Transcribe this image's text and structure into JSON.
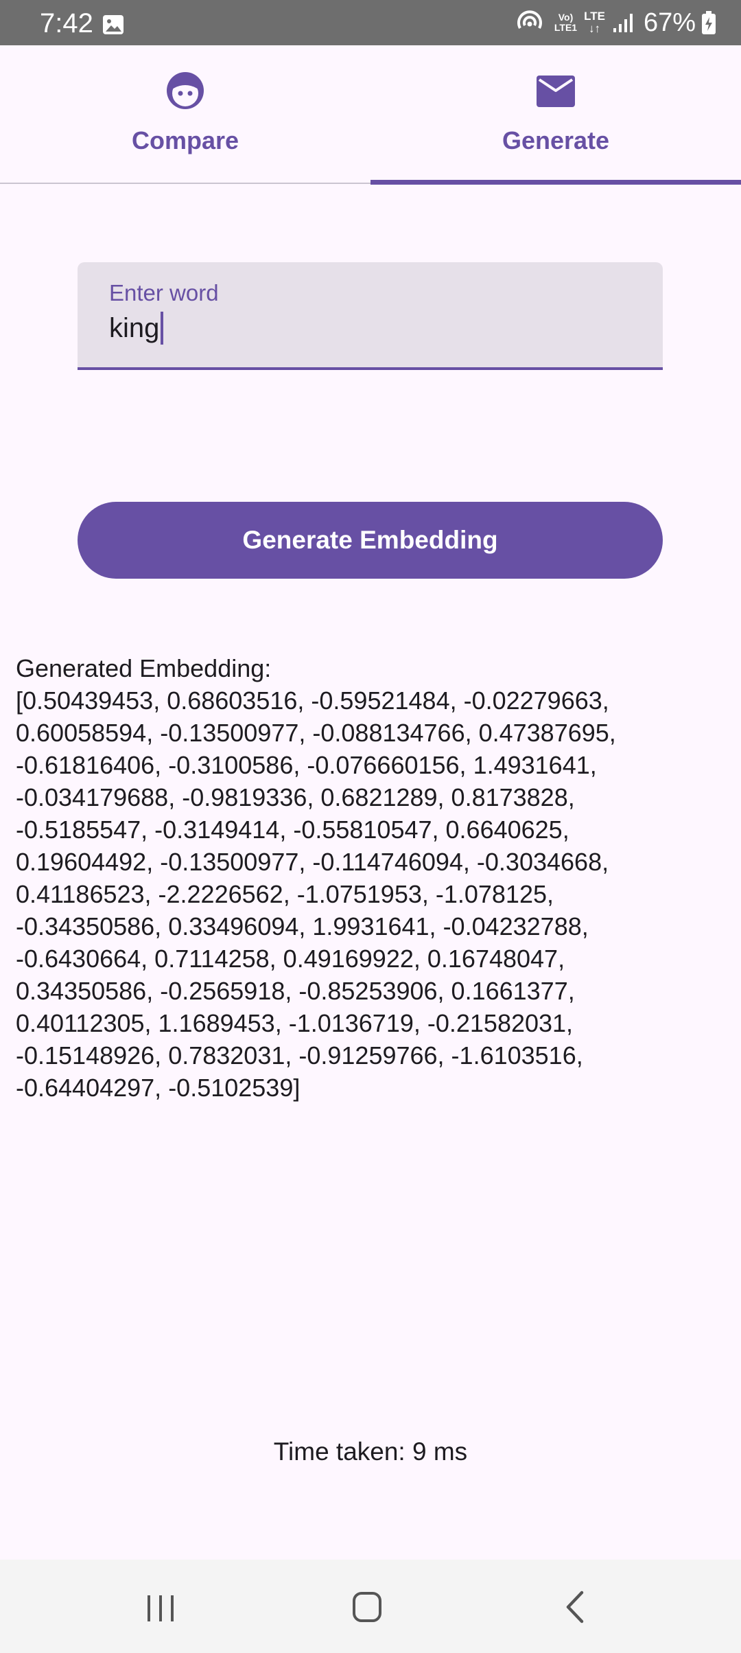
{
  "status_bar": {
    "time": "7:42",
    "battery": "67%",
    "volte_line1": "Vo)",
    "volte_line2": "LTE1",
    "lte": "LTE"
  },
  "tabs": [
    {
      "label": "Compare",
      "icon": "face-icon",
      "selected": false
    },
    {
      "label": "Generate",
      "icon": "mail-icon",
      "selected": true
    }
  ],
  "input": {
    "label": "Enter word",
    "value": "king"
  },
  "button": {
    "label": "Generate Embedding"
  },
  "output": {
    "text": "Generated Embedding:\n[0.50439453, 0.68603516, -0.59521484, -0.02279663,\n0.60058594, -0.13500977, -0.088134766, 0.47387695,\n-0.61816406, -0.3100586, -0.076660156, 1.4931641,\n-0.034179688, -0.9819336, 0.6821289, 0.8173828,\n-0.5185547, -0.3149414, -0.55810547, 0.6640625,\n0.19604492, -0.13500977, -0.114746094, -0.3034668,\n0.41186523, -2.2226562, -1.0751953, -1.078125,\n-0.34350586, 0.33496094, 1.9931641, -0.04232788,\n-0.6430664, 0.7114258, 0.49169922, 0.16748047,\n0.34350586, -0.2565918, -0.85253906, 0.1661377,\n0.40112305, 1.1689453, -1.0136719, -0.21582031,\n-0.15148926, 0.7832031, -0.91259766, -1.6103516,\n-0.64404297, -0.5102539]",
    "time_taken": "Time taken: 9 ms"
  },
  "colors": {
    "primary": "#6750a4",
    "background": "#fef7ff",
    "field_bg": "#e6e0e9",
    "status_bar": "#6e6e6e",
    "nav_bar": "#f4f4f4"
  }
}
